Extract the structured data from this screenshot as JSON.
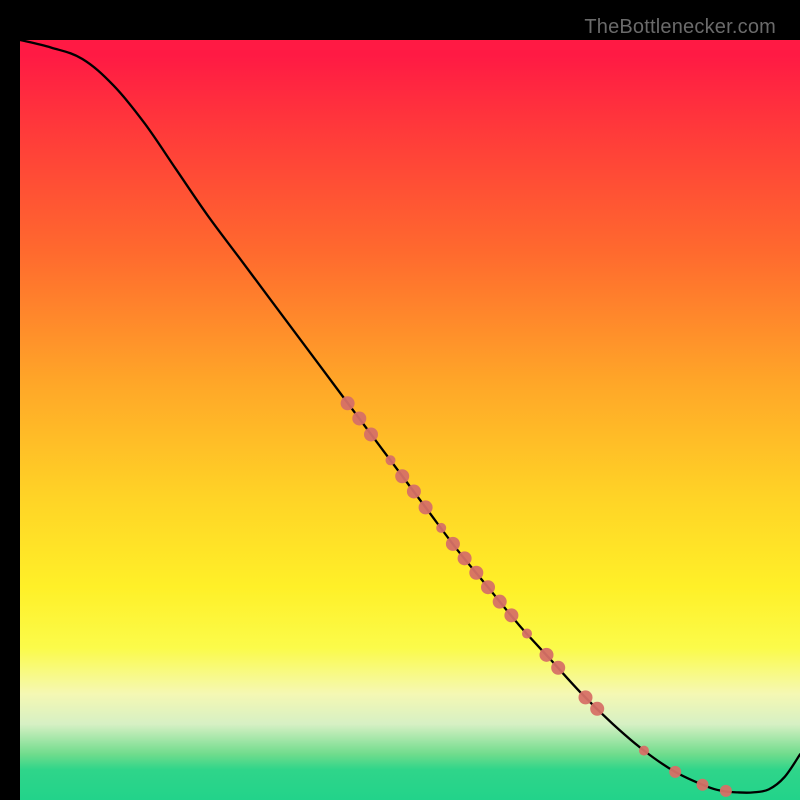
{
  "attribution": "TheBottlenecker.com",
  "colors": {
    "dot": "#d67066",
    "curve": "#000000",
    "gradient_top": "#ff1a44",
    "gradient_bottom": "#22d38a"
  },
  "chart_data": {
    "type": "line",
    "title": "",
    "xlabel": "",
    "ylabel": "",
    "xlim": [
      0,
      100
    ],
    "ylim": [
      0,
      100
    ],
    "curve": {
      "x": [
        0,
        4,
        8,
        12,
        16,
        20,
        24,
        28,
        32,
        36,
        40,
        44,
        48,
        52,
        56,
        60,
        64,
        68,
        72,
        76,
        80,
        84,
        88,
        90,
        92,
        94,
        96,
        98,
        100
      ],
      "y": [
        100,
        99,
        97.5,
        94,
        89,
        83,
        77,
        71.5,
        66,
        60.5,
        55,
        49.5,
        44,
        38.5,
        33,
        28,
        23,
        18.5,
        14,
        10,
        6.5,
        3.7,
        1.8,
        1.2,
        1.0,
        1.0,
        1.4,
        3.0,
        6.0
      ]
    },
    "points": [
      {
        "x": 42,
        "y": 52.2,
        "r": 7
      },
      {
        "x": 43.5,
        "y": 50.2,
        "r": 7
      },
      {
        "x": 45,
        "y": 48.1,
        "r": 7
      },
      {
        "x": 47.5,
        "y": 44.7,
        "r": 5
      },
      {
        "x": 49,
        "y": 42.6,
        "r": 7
      },
      {
        "x": 50.5,
        "y": 40.6,
        "r": 7
      },
      {
        "x": 52,
        "y": 38.5,
        "r": 7
      },
      {
        "x": 54,
        "y": 35.8,
        "r": 5
      },
      {
        "x": 55.5,
        "y": 33.7,
        "r": 7
      },
      {
        "x": 57,
        "y": 31.8,
        "r": 7
      },
      {
        "x": 58.5,
        "y": 29.9,
        "r": 7
      },
      {
        "x": 60,
        "y": 28.0,
        "r": 7
      },
      {
        "x": 61.5,
        "y": 26.1,
        "r": 7
      },
      {
        "x": 63,
        "y": 24.3,
        "r": 7
      },
      {
        "x": 65,
        "y": 21.9,
        "r": 5
      },
      {
        "x": 67.5,
        "y": 19.1,
        "r": 7
      },
      {
        "x": 69,
        "y": 17.4,
        "r": 7
      },
      {
        "x": 72.5,
        "y": 13.5,
        "r": 7
      },
      {
        "x": 74,
        "y": 12.0,
        "r": 7
      },
      {
        "x": 80,
        "y": 6.5,
        "r": 5
      },
      {
        "x": 84,
        "y": 3.7,
        "r": 6
      },
      {
        "x": 87.5,
        "y": 2.0,
        "r": 6
      },
      {
        "x": 90.5,
        "y": 1.2,
        "r": 6
      }
    ]
  }
}
